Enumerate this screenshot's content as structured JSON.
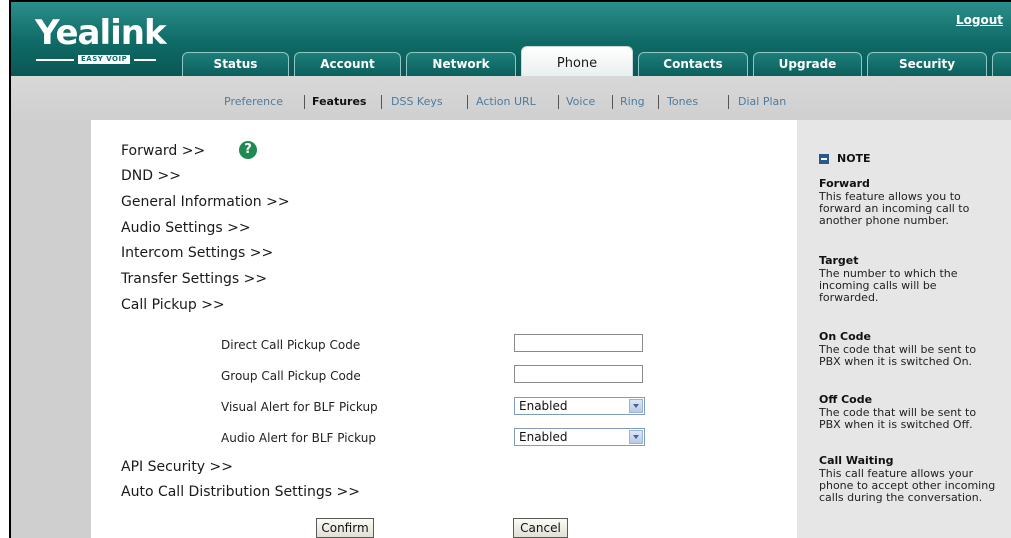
{
  "header": {
    "logo": "Yealink",
    "logo_sub": "EASY VOIP",
    "logout": "Logout",
    "tabs": [
      {
        "label": "Status"
      },
      {
        "label": "Account"
      },
      {
        "label": "Network"
      },
      {
        "label": "Phone",
        "active": true
      },
      {
        "label": "Contacts"
      },
      {
        "label": "Upgrade"
      },
      {
        "label": "Security"
      }
    ]
  },
  "subnav": {
    "items": [
      "Preference",
      "Features",
      "DSS Keys",
      "Action URL",
      "Voice",
      "Ring",
      "Tones",
      "Dial Plan"
    ],
    "active": "Features"
  },
  "sections": {
    "forward": "Forward >>",
    "dnd": "DND >>",
    "general": "General Information >>",
    "audio": "Audio Settings >>",
    "intercom": "Intercom Settings >>",
    "transfer": "Transfer Settings >>",
    "pickup": "Call Pickup >>",
    "api": "API Security >>",
    "acd": "Auto Call Distribution Settings >>"
  },
  "help_icon": "?",
  "pickup_fields": {
    "direct_label": "Direct Call Pickup Code",
    "direct_value": "",
    "group_label": "Group Call Pickup Code",
    "group_value": "",
    "visual_label": "Visual Alert for BLF Pickup",
    "visual_value": "Enabled",
    "audio_label": "Audio Alert for BLF Pickup",
    "audio_value": "Enabled"
  },
  "buttons": {
    "confirm": "Confirm",
    "cancel": "Cancel"
  },
  "note": {
    "heading": "NOTE",
    "items": [
      {
        "title": "Forward",
        "text": "This feature allows you to forward an incoming call to another phone number."
      },
      {
        "title": "Target",
        "text": "The number to which the incoming calls will be forwarded."
      },
      {
        "title": "On Code",
        "text": "The code that will be sent to PBX when it is switched On."
      },
      {
        "title": "Off Code",
        "text": "The code that will be sent to PBX when it is switched Off."
      },
      {
        "title": "Call Waiting",
        "text": "This call feature allows your phone to accept other incoming calls during the conversation."
      }
    ]
  },
  "colors": {
    "header": "#0f6a66",
    "subnav_bg": "#d4d4d4",
    "note_bg": "#e6e6e6",
    "help_icon": "#1f8a52"
  }
}
